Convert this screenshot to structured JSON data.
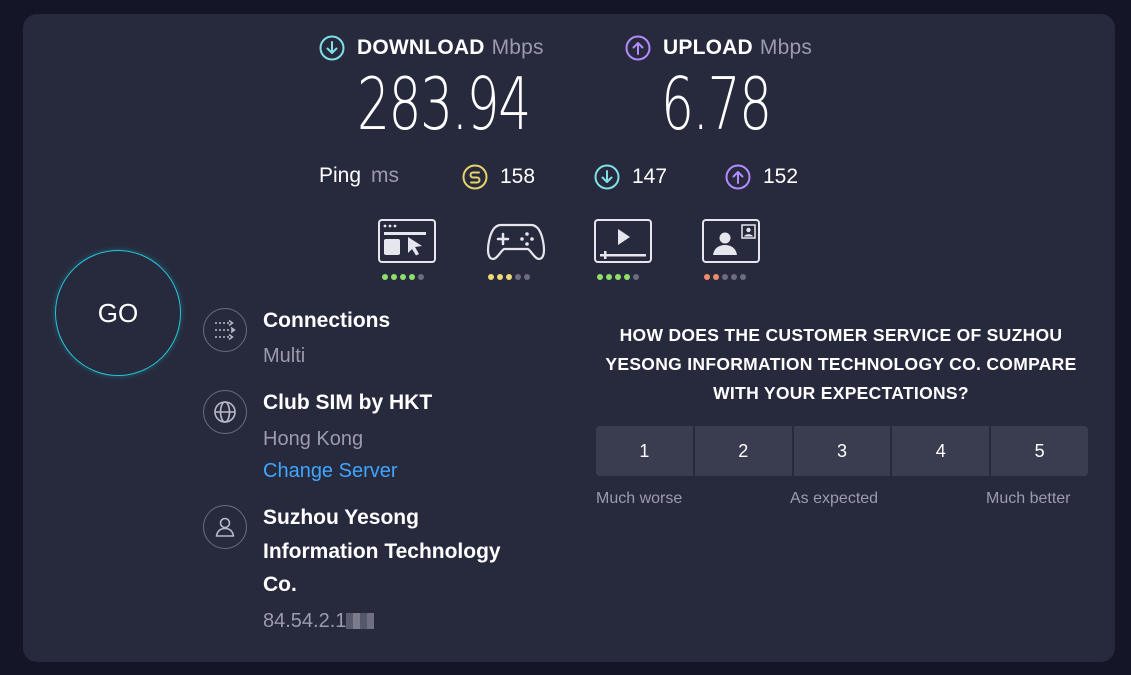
{
  "download": {
    "label": "DOWNLOAD",
    "unit": "Mbps",
    "value": "283.94",
    "color": "#7fe0e8"
  },
  "upload": {
    "label": "UPLOAD",
    "unit": "Mbps",
    "value": "6.78",
    "color": "#b48bff"
  },
  "ping": {
    "label": "Ping",
    "unit": "ms",
    "idle": "158",
    "download": "147",
    "upload": "152",
    "idle_color": "#e7d26a"
  },
  "quality": [
    {
      "icon": "browsing-icon",
      "filled": 4,
      "total": 5,
      "color": "#8fe06a"
    },
    {
      "icon": "gaming-controller-icon",
      "filled": 3,
      "total": 5,
      "color": "#f0d878"
    },
    {
      "icon": "video-streaming-icon",
      "filled": 4,
      "total": 5,
      "color": "#8fe06a"
    },
    {
      "icon": "video-call-icon",
      "filled": 2,
      "total": 5,
      "color": "#f08a6a"
    }
  ],
  "go_label": "GO",
  "connections": {
    "title": "Connections",
    "value": "Multi"
  },
  "server": {
    "title": "Club SIM by HKT",
    "location": "Hong Kong",
    "change_label": "Change Server"
  },
  "provider": {
    "name_line1": "Suzhou Yesong",
    "name_line2": "Information Technology",
    "name_line3": "Co.",
    "ip": "84.54.2.1"
  },
  "survey": {
    "question_line1": "HOW DOES THE CUSTOMER SERVICE OF SUZHOU",
    "question_line2": "YESONG INFORMATION TECHNOLOGY CO. COMPARE",
    "question_line3": "WITH YOUR EXPECTATIONS?",
    "options": [
      "1",
      "2",
      "3",
      "4",
      "5"
    ],
    "low_label": "Much worse",
    "mid_label": "As expected",
    "high_label": "Much better"
  },
  "accent_color": "#22c7d8",
  "link_color": "#3ea6ff"
}
